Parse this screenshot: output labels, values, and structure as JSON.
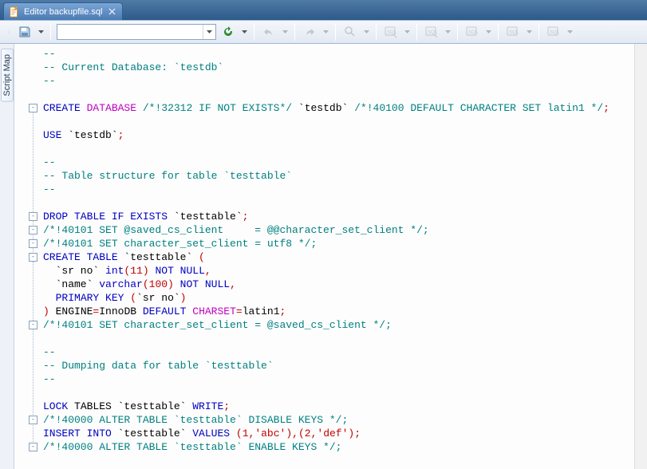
{
  "tab": {
    "title": "Editor backupfile.sql"
  },
  "toolbar": {
    "combo_value": ""
  },
  "side": {
    "label": "Script Map"
  },
  "code": {
    "lines": [
      {
        "t": "cmt",
        "txt": "--"
      },
      {
        "t": "cmt",
        "txt": "-- Current Database: `testdb`"
      },
      {
        "t": "cmt",
        "txt": "--"
      },
      {
        "t": "blank",
        "txt": ""
      },
      {
        "t": "create_db",
        "kw1": "CREATE",
        "kw2": "DATABASE",
        "c1": "/*!32312 IF NOT EXISTS*/",
        "id": "`testdb`",
        "c2": "/*!40100 DEFAULT CHARACTER SET latin1 */",
        "sc": ";"
      },
      {
        "t": "blank",
        "txt": ""
      },
      {
        "t": "use",
        "kw": "USE",
        "id": "`testdb`",
        "sc": ";"
      },
      {
        "t": "blank",
        "txt": ""
      },
      {
        "t": "cmt",
        "txt": "--"
      },
      {
        "t": "cmt",
        "txt": "-- Table structure for table `testtable`"
      },
      {
        "t": "cmt",
        "txt": "--"
      },
      {
        "t": "blank",
        "txt": ""
      },
      {
        "t": "drop",
        "kw": "DROP TABLE IF EXISTS",
        "id": "`testtable`",
        "sc": ";"
      },
      {
        "t": "setcmt",
        "txt": "/*!40101 SET @saved_cs_client     = @@character_set_client */;"
      },
      {
        "t": "setcmt",
        "txt": "/*!40101 SET character_set_client = utf8 */;"
      },
      {
        "t": "create_tbl",
        "kw": "CREATE TABLE",
        "id": "`testtable`",
        "par": "("
      },
      {
        "t": "col",
        "pad": "  ",
        "id": "`sr no`",
        "typ": "int",
        "par": "(",
        "n": "11",
        "par2": ")",
        "mods": "NOT NULL",
        "comma": ","
      },
      {
        "t": "col",
        "pad": "  ",
        "id": "`name`",
        "typ": "varchar",
        "par": "(",
        "n": "100",
        "par2": ")",
        "mods": "NOT NULL",
        "comma": ","
      },
      {
        "t": "pk",
        "pad": "  ",
        "kw": "PRIMARY KEY",
        "par": "(",
        "id": "`sr no`",
        "par2": ")"
      },
      {
        "t": "endtbl",
        "par": ")",
        "eng": "ENGINE",
        "eq": "=",
        "engv": "InnoDB",
        "deflt": "DEFAULT",
        "cs": "CHARSET",
        "eq2": "=",
        "csv": "latin1",
        "sc": ";"
      },
      {
        "t": "setcmt",
        "txt": "/*!40101 SET character_set_client = @saved_cs_client */;"
      },
      {
        "t": "blank",
        "txt": ""
      },
      {
        "t": "cmt",
        "txt": "--"
      },
      {
        "t": "cmt",
        "txt": "-- Dumping data for table `testtable`"
      },
      {
        "t": "cmt",
        "txt": "--"
      },
      {
        "t": "blank",
        "txt": ""
      },
      {
        "t": "lock",
        "kw1": "LOCK",
        "id0": "TABLES",
        "id": "`testtable`",
        "kw2": "WRITE",
        "sc": ";"
      },
      {
        "t": "setcmt",
        "txt": "/*!40000 ALTER TABLE `testtable` DISABLE KEYS */;"
      },
      {
        "t": "insert",
        "kw": "INSERT INTO",
        "id": "`testtable`",
        "kw2": "VALUES",
        "vals": [
          [
            "1",
            "'abc'"
          ],
          [
            "2",
            "'def'"
          ]
        ],
        "sc": ";"
      },
      {
        "t": "setcmt",
        "txt": "/*!40000 ALTER TABLE `testtable` ENABLE KEYS */;"
      }
    ]
  },
  "folds": [
    {
      "line": 4,
      "open": true,
      "span": 25
    },
    {
      "line": 12,
      "open": true,
      "span": 0
    },
    {
      "line": 13,
      "open": true,
      "span": 0
    },
    {
      "line": 14,
      "open": true,
      "span": 0
    },
    {
      "line": 15,
      "open": true,
      "span": 4
    },
    {
      "line": 20,
      "open": true,
      "span": 0
    },
    {
      "line": 27,
      "open": true,
      "span": 0
    },
    {
      "line": 29,
      "open": true,
      "span": 0
    }
  ]
}
